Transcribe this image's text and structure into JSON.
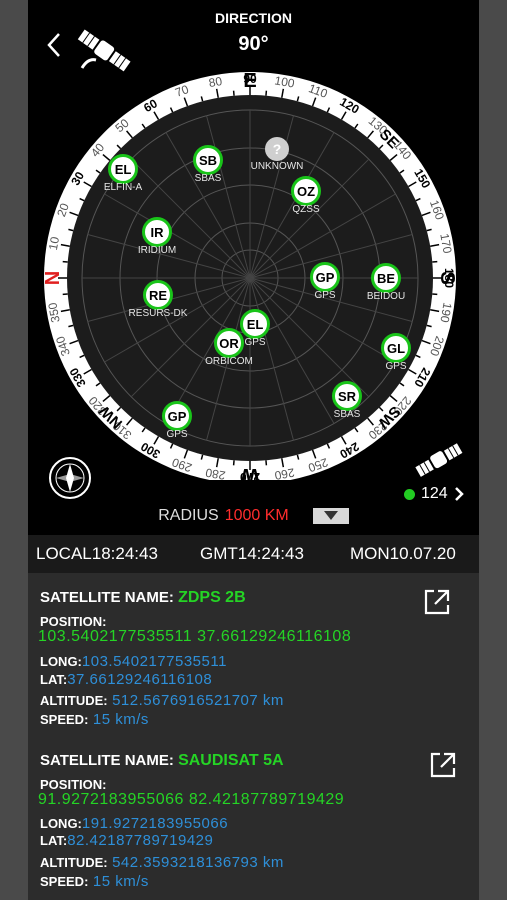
{
  "header": {
    "title": "DIRECTION",
    "direction": "90°"
  },
  "radar": {
    "cardinals": {
      "E": "E",
      "S": "S",
      "W": "W",
      "N": "N"
    },
    "degree_labels": [
      "70",
      "80",
      "90",
      "100",
      "110",
      "120",
      "130",
      "140",
      "150",
      "160",
      "170",
      "180",
      "190",
      "200",
      "210",
      "220",
      "230",
      "240",
      "250",
      "260",
      "270",
      "280",
      "290",
      "300",
      "310",
      "320",
      "330",
      "340",
      "350",
      "10",
      "20",
      "30",
      "40",
      "50",
      "60"
    ],
    "intercardinals": [
      "SE",
      "SW",
      "NW"
    ],
    "satellites": [
      {
        "code": "EL",
        "name": "ELFIN-A"
      },
      {
        "code": "SB",
        "name": "SBAS"
      },
      {
        "code": "?",
        "name": "UNKNOWN"
      },
      {
        "code": "OZ",
        "name": "QZSS"
      },
      {
        "code": "IR",
        "name": "IRIDIUM"
      },
      {
        "code": "GP",
        "name": "GPS"
      },
      {
        "code": "BE",
        "name": "BEIDOU"
      },
      {
        "code": "RE",
        "name": "RESURS-DK"
      },
      {
        "code": "EL",
        "name": "GPS"
      },
      {
        "code": "OR",
        "name": "ORBICOM"
      },
      {
        "code": "GL",
        "name": "GPS"
      },
      {
        "code": "SR",
        "name": "SBAS"
      },
      {
        "code": "GP",
        "name": "GPS"
      }
    ]
  },
  "count": "124",
  "radius": {
    "label": "RADIUS",
    "value": "1000 KM"
  },
  "time_bar": {
    "local": "LOCAL18:24:43",
    "gmt": "GMT14:24:43",
    "date": "MON10.07.20"
  },
  "satellites_info": [
    {
      "name_label": "SATELLITE NAME:",
      "name": "ZDPS 2B",
      "position_label": "POSITION:",
      "position": "103.5402177535511 37.66129246116108",
      "long_label": "LONG:",
      "long": "103.5402177535511",
      "lat_label": "LAT:",
      "lat": "37.66129246116108",
      "altitude_label": "ALTITUDE:",
      "altitude": "512.5676916521707  km",
      "speed_label": "SPEED:",
      "speed": "15  km/s"
    },
    {
      "name_label": "SATELLITE NAME:",
      "name": "SAUDISAT 5A",
      "position_label": "POSITION:",
      "position": "91.9272183955066 82.42187789719429",
      "long_label": "LONG:",
      "long": "191.9272183955066",
      "lat_label": "LAT:",
      "lat": "82.42187789719429",
      "altitude_label": "ALTITUDE:",
      "altitude": "542.3593218136793  km",
      "speed_label": "SPEED:",
      "speed": "15  km/s"
    }
  ],
  "colors": {
    "accent_green": "#25d425",
    "radius_red": "#ff2d2d",
    "value_blue": "#2e8fd8",
    "north_red": "#e02020"
  },
  "icons": [
    "back-arrow-icon",
    "satellite-icon",
    "compass-icon",
    "chevron-right-icon",
    "external-link-icon",
    "dropdown-arrow-icon"
  ]
}
